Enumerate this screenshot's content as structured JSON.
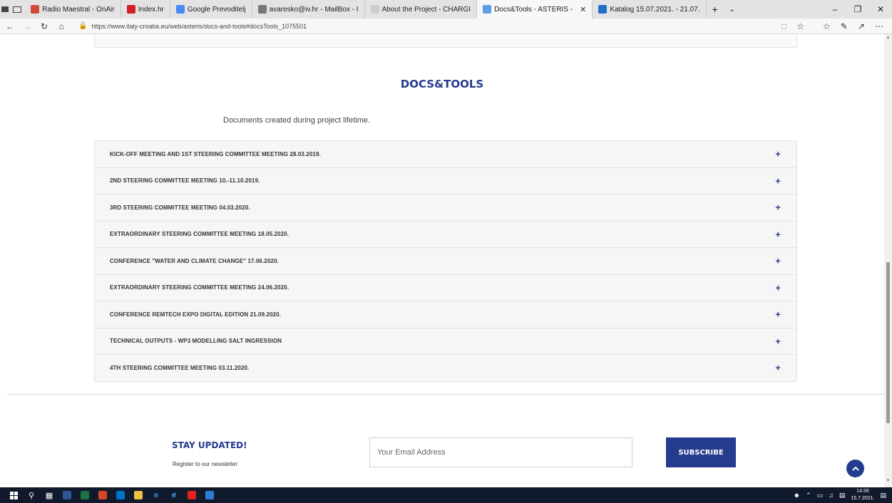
{
  "browser": {
    "tabs": [
      {
        "label": "Radio Maestral - OnAir",
        "favicon_color": "#d04a3a",
        "active": false
      },
      {
        "label": "Index.hr",
        "favicon_color": "#d21f26",
        "active": false
      },
      {
        "label": "Google Prevoditelj",
        "favicon_color": "#4a8af4",
        "active": false
      },
      {
        "label": "avaresko@iv.hr - MailBox - I",
        "favicon_color": "#777777",
        "active": false
      },
      {
        "label": "About the Project - CHARGI",
        "favicon_color": "#cccccc",
        "active": false
      },
      {
        "label": "Docs&Tools - ASTERIS -",
        "favicon_color": "#5aa0e0",
        "active": true
      },
      {
        "label": "Katalog 15.07.2021. - 21.07.",
        "favicon_color": "#1f6fc5",
        "active": false
      }
    ],
    "url": "https://www.italy-croatia.eu/web/asteris/docs-and-tools#docsTools_1075501"
  },
  "page": {
    "title": "DOCS&TOOLS",
    "subtitle": "Documents created during project lifetime.",
    "accordion": [
      "KICK-OFF MEETING AND 1ST STEERING COMMITTEE MEETING 28.03.2019.",
      "2ND STEERING COMMITTEE MEETING 10.-11.10.2019.",
      "3RD STEERING COMMITTEE MEETING 04.03.2020.",
      "EXTRAORDINARY STEERING COMMITTEE MEETING 18.05.2020.",
      "CONFERENCE \"WATER AND CLIMATE CHANGE\" 17.06.2020.",
      "EXTRAORDINARY STEERING COMMITTEE MEETING 24.06.2020.",
      "CONFERENCE REMTECH EXPO DIGITAL EDITION 21.09.2020.",
      "TECHNICAL OUTPUTS - WP3 MODELLING SALT INGRESSION",
      "4TH STEERING COMMITTEE MEETING 03.11.2020."
    ],
    "newsletter": {
      "title": "STAY UPDATED!",
      "subtitle": "Register to our newsletter",
      "email_placeholder": "Your Email Address",
      "subscribe_label": "SUBSCRIBE"
    }
  },
  "taskbar": {
    "time": "14:26",
    "date": "15.7.2021."
  }
}
